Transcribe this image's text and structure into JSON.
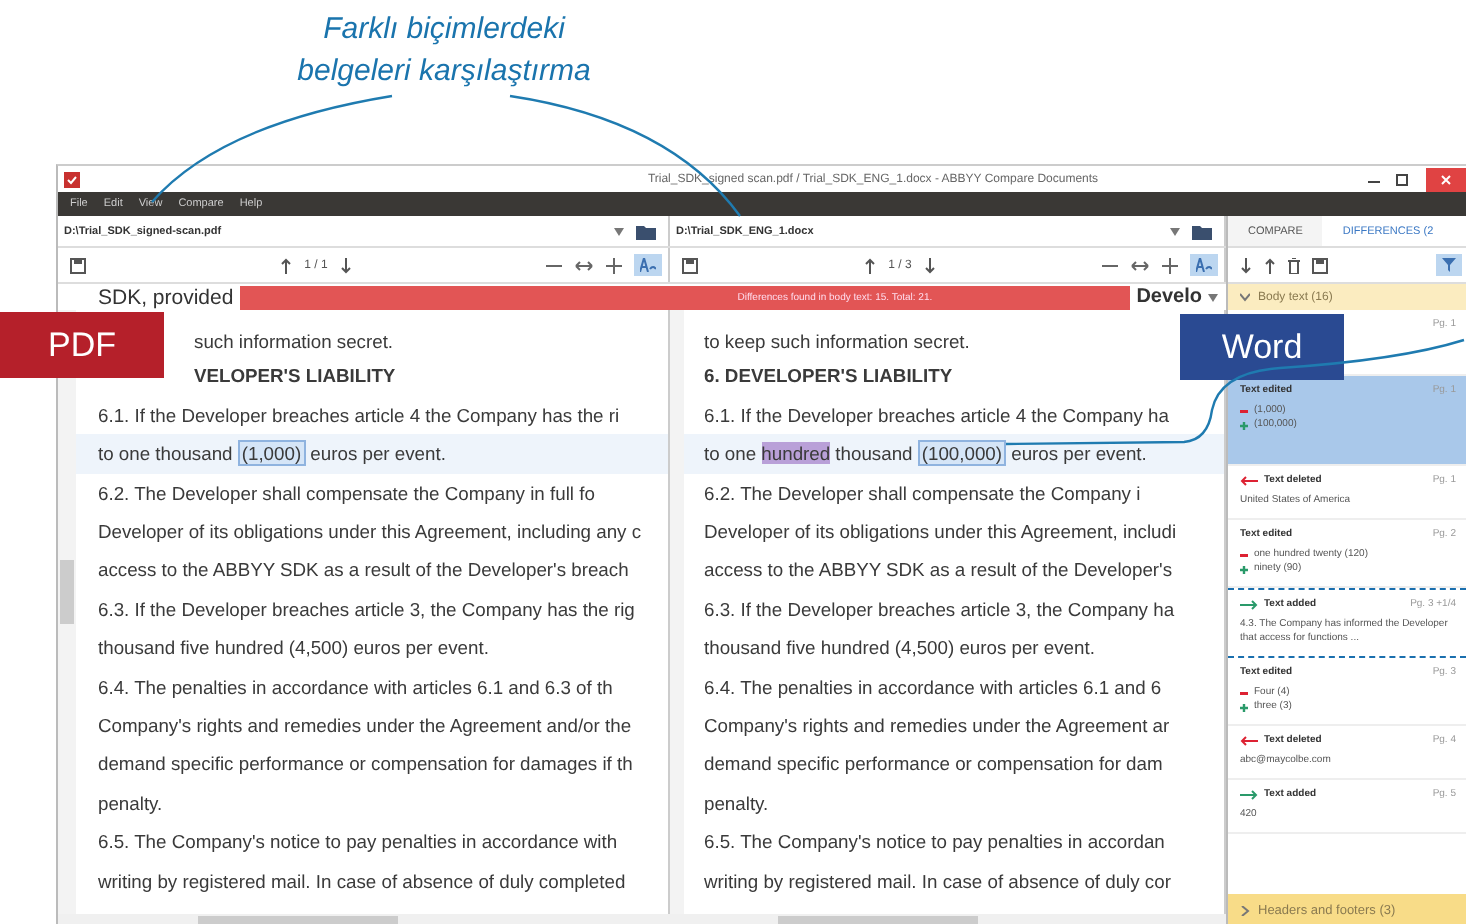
{
  "caption": "Farklı biçimlerdeki belgeleri karşılaştırma",
  "labels": [
    {
      "text": "PDF",
      "color": "#b5202a"
    },
    {
      "text": "Word",
      "color": "#2a4a92"
    }
  ],
  "window": {
    "title": "Trial_SDK_signed scan.pdf / Trial_SDK_ENG_1.docx - ABBYY Compare Documents",
    "menu": [
      "File",
      "Edit",
      "View",
      "Compare",
      "Help"
    ]
  },
  "banner": {
    "lead": "SDK, provided",
    "text": "Differences found in body text: 15. Total: 21.",
    "tail": "Develo"
  },
  "panes": [
    {
      "path": "D:\\Trial_SDK_signed-scan.pdf",
      "page": "1 / 1",
      "match_on": true,
      "paragraphs": [
        {
          "kind": "text",
          "covered": true,
          "lines": [
            "such information secret."
          ]
        },
        {
          "kind": "heading",
          "covered": true,
          "lines": [
            "VELOPER'S LIABILITY"
          ]
        },
        {
          "kind": "text",
          "covered": false,
          "lines": [
            "6.1.  If the Developer breaches article 4 the Company has the ri"
          ],
          "changed_line": [
            {
              "text": "to one thousand ",
              "kind": "plain"
            },
            {
              "text": "(1,000)",
              "kind": "changed"
            },
            {
              "text": " euros per event.",
              "kind": "plain"
            }
          ]
        },
        {
          "kind": "text",
          "covered": false,
          "lines": [
            "6.2. The Developer shall compensate the Company in full fo",
            "Developer of its obligations under this Agreement, including any c",
            "access to the ABBYY SDK as a result of the Developer's breach"
          ]
        },
        {
          "kind": "text",
          "covered": false,
          "lines": [
            "6.3.  If the Developer breaches article 3, the Company has the rig",
            "thousand five hundred (4,500) euros per event."
          ]
        },
        {
          "kind": "text",
          "covered": false,
          "lines": [
            "6.4. The penalties in accordance with articles 6.1 and 6.3 of th",
            "Company's rights and remedies under the Agreement and/or the",
            "demand specific performance or compensation for damages if th",
            "penalty."
          ]
        },
        {
          "kind": "text",
          "covered": false,
          "lines": [
            "6.5. The Company's notice to pay penalties in accordance with",
            "writing by registered mail. In case of absence of duly completed"
          ]
        }
      ]
    },
    {
      "path": "D:\\Trial_SDK_ENG_1.docx",
      "page": "1 / 3",
      "match_on": true,
      "paragraphs": [
        {
          "kind": "text",
          "covered": false,
          "lines": [
            "to keep such information secret."
          ]
        },
        {
          "kind": "heading",
          "covered": false,
          "lines": [
            "6.     DEVELOPER'S LIABILITY"
          ]
        },
        {
          "kind": "text",
          "covered": false,
          "lines": [
            "6.1.  If the Developer breaches article 4 the Company ha"
          ],
          "changed_line": [
            {
              "text": "to one ",
              "kind": "plain"
            },
            {
              "text": "hundred",
              "kind": "added"
            },
            {
              "text": " thousand ",
              "kind": "plain"
            },
            {
              "text": "(100,000)",
              "kind": "changed"
            },
            {
              "text": " euros per event.",
              "kind": "plain"
            }
          ]
        },
        {
          "kind": "text",
          "covered": false,
          "lines": [
            "6.2. The Developer shall compensate the Company i",
            "Developer of its obligations under this Agreement, includi",
            "access to the ABBYY SDK as a result of the Developer's"
          ]
        },
        {
          "kind": "text",
          "covered": false,
          "lines": [
            "6.3.  If the Developer breaches article 3, the Company ha",
            "thousand five hundred (4,500) euros per event."
          ]
        },
        {
          "kind": "text",
          "covered": false,
          "lines": [
            "6.4. The penalties in accordance with articles 6.1 and 6",
            "Company's rights and remedies under the Agreement ar",
            "demand specific performance or compensation for dam",
            "penalty."
          ]
        },
        {
          "kind": "text",
          "covered": false,
          "lines": [
            "6.5. The Company's notice to pay penalties in accordan",
            "writing by registered mail. In case of absence of duly cor"
          ]
        }
      ]
    }
  ],
  "sidebar": {
    "tabs": [
      {
        "label": "COMPARE",
        "selected": false
      },
      {
        "label": "DIFFERENCES (2",
        "selected": true
      }
    ],
    "filter_on": true,
    "groups": [
      {
        "title": "Body text (16)",
        "expanded": true,
        "items": [
          {
            "kind": "hidden",
            "page": "Pg. 1"
          },
          {
            "kind": "edited",
            "title": "Text edited",
            "page": "Pg. 1",
            "selected": true,
            "callout": false,
            "removed": "(1,000)",
            "added": "(100,000)"
          },
          {
            "kind": "deleted",
            "title": "Text deleted",
            "page": "Pg. 1",
            "selected": false,
            "callout": false,
            "body": "United States of America"
          },
          {
            "kind": "edited",
            "title": "Text edited",
            "page": "Pg. 2",
            "selected": false,
            "callout": false,
            "removed": "one hundred twenty (120)",
            "added": "ninety (90)"
          },
          {
            "kind": "added",
            "title": "Text added",
            "page": "Pg. 3 +1/4",
            "selected": false,
            "callout": true,
            "body": "4.3. The Company has informed the Developer that access for functions ..."
          },
          {
            "kind": "edited",
            "title": "Text edited",
            "page": "Pg. 3",
            "selected": false,
            "callout": false,
            "removed": "Four (4)",
            "added": "three (3)"
          },
          {
            "kind": "deleted",
            "title": "Text deleted",
            "page": "Pg. 4",
            "selected": false,
            "callout": false,
            "body": "abc@maycolbe.com"
          },
          {
            "kind": "added",
            "title": "Text added",
            "page": "Pg. 5",
            "selected": false,
            "callout": false,
            "body": "420"
          }
        ]
      },
      {
        "title": "Headers and footers (3)",
        "expanded": false
      }
    ]
  }
}
